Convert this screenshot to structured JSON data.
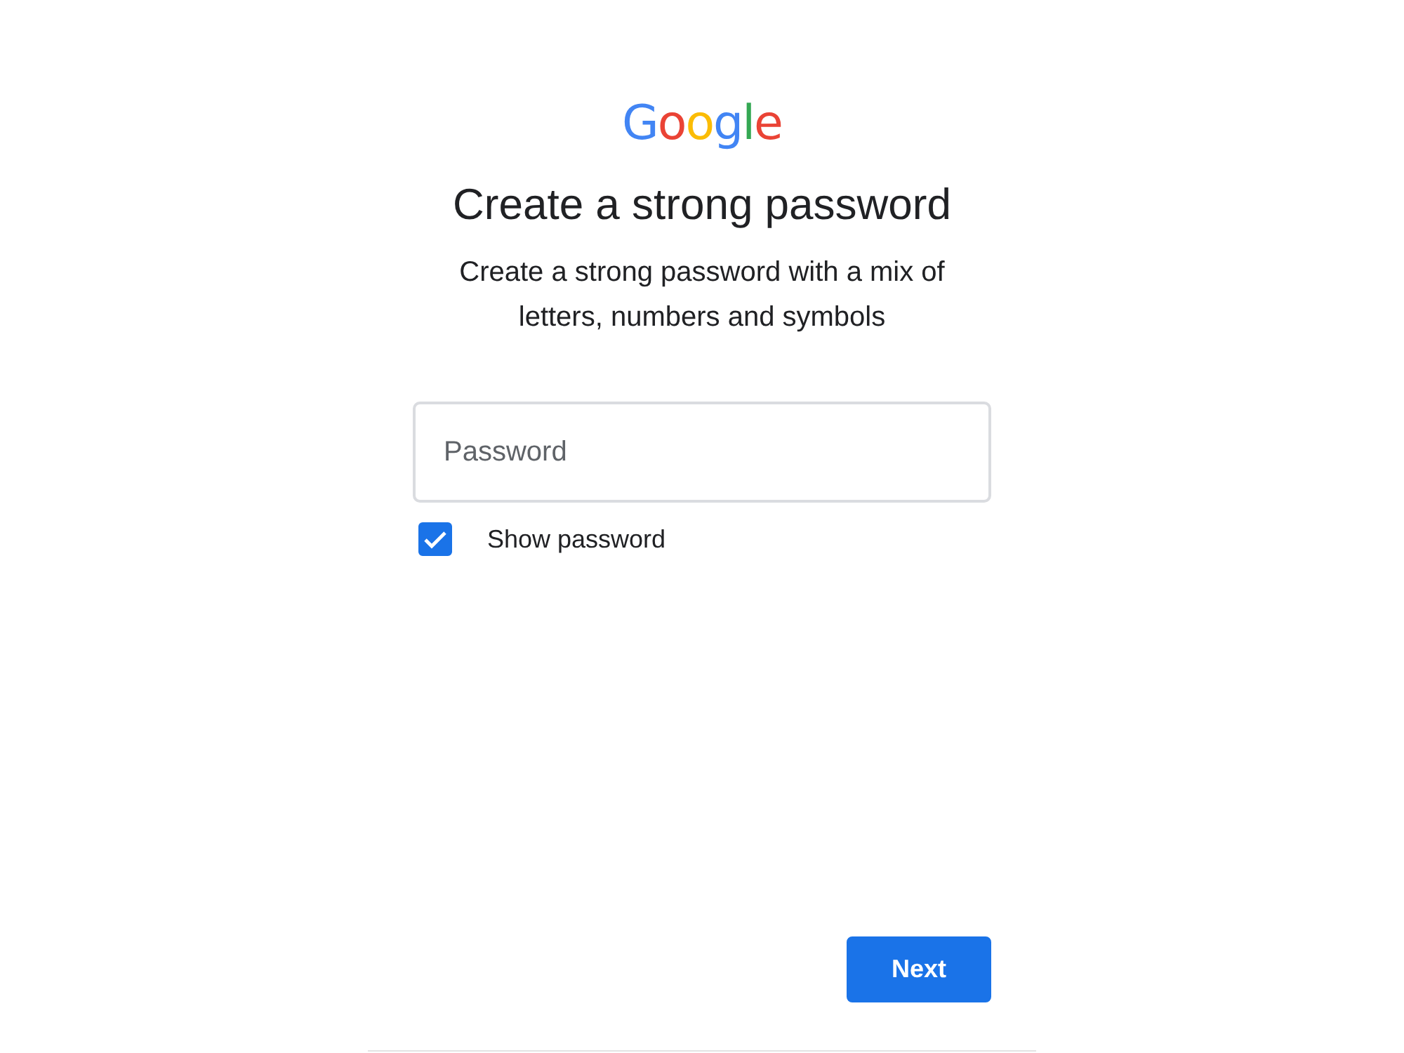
{
  "logo": "Google",
  "title": "Create a strong password",
  "subtitle": "Create a strong password with a mix of letters, numbers and symbols",
  "password_field": {
    "placeholder": "Password"
  },
  "show_password": {
    "label": "Show password",
    "checked": true
  },
  "buttons": [
    {
      "label": "Next",
      "kind": "primary"
    }
  ]
}
